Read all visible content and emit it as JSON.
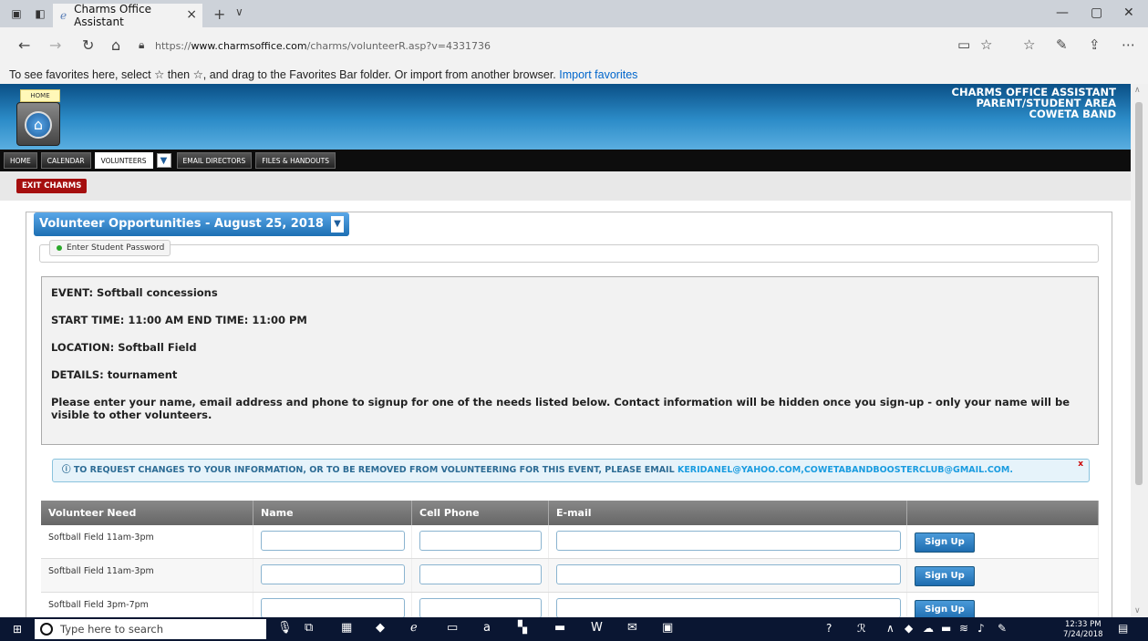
{
  "browser": {
    "tab_title": "Charms Office Assistant",
    "url_prefix": "https://",
    "url_domain": "www.charmsoffice.com",
    "url_path": "/charms/volunteerR.asp?v=4331736",
    "favbar_text": "To see favorites here, select ☆ then ☆, and drag to the Favorites Bar folder. Or import from another browser.",
    "favbar_link": "Import favorites"
  },
  "header": {
    "home_tag": "HOME",
    "brand_lines": [
      "CHARMS OFFICE ASSISTANT",
      "PARENT/STUDENT AREA",
      "COWETA BAND"
    ]
  },
  "menu": {
    "items": [
      "HOME",
      "CALENDAR",
      "VOLUNTEERS",
      "EMAIL DIRECTORS",
      "FILES & HANDOUTS"
    ],
    "selected": "VOLUNTEERS"
  },
  "exit_label": "EXIT CHARMS",
  "panel": {
    "title": "Volunteer Opportunities - August 25, 2018",
    "password_button": "Enter Student Password"
  },
  "event": {
    "event_line": "EVENT: Softball concessions",
    "time_line": "START TIME: 11:00 AM END TIME: 11:00 PM",
    "location_line": "LOCATION: Softball Field",
    "details_line": "DETAILS: tournament",
    "instructions": "Please enter your name, email address and phone to signup for one of the needs listed below. Contact information will be hidden once you sign-up - only your name will be visible to other volunteers."
  },
  "alert": {
    "text": "TO REQUEST CHANGES TO YOUR INFORMATION, OR TO BE REMOVED FROM VOLUNTEERING FOR THIS EVENT, PLEASE EMAIL",
    "email": "KERIDANEL@YAHOO.COM,COWETABANDBOOSTERCLUB@GMAIL.COM.",
    "close": "x"
  },
  "table": {
    "headers": [
      "Volunteer Need",
      "Name",
      "Cell Phone",
      "E-mail",
      ""
    ],
    "rows": [
      {
        "need": "Softball Field 11am-3pm",
        "button": "Sign Up"
      },
      {
        "need": "Softball Field 11am-3pm",
        "button": "Sign Up"
      },
      {
        "need": "Softball Field 3pm-7pm",
        "button": "Sign Up"
      }
    ]
  },
  "taskbar": {
    "search_placeholder": "Type here to search",
    "time": "12:33 PM",
    "date": "7/24/2018"
  }
}
